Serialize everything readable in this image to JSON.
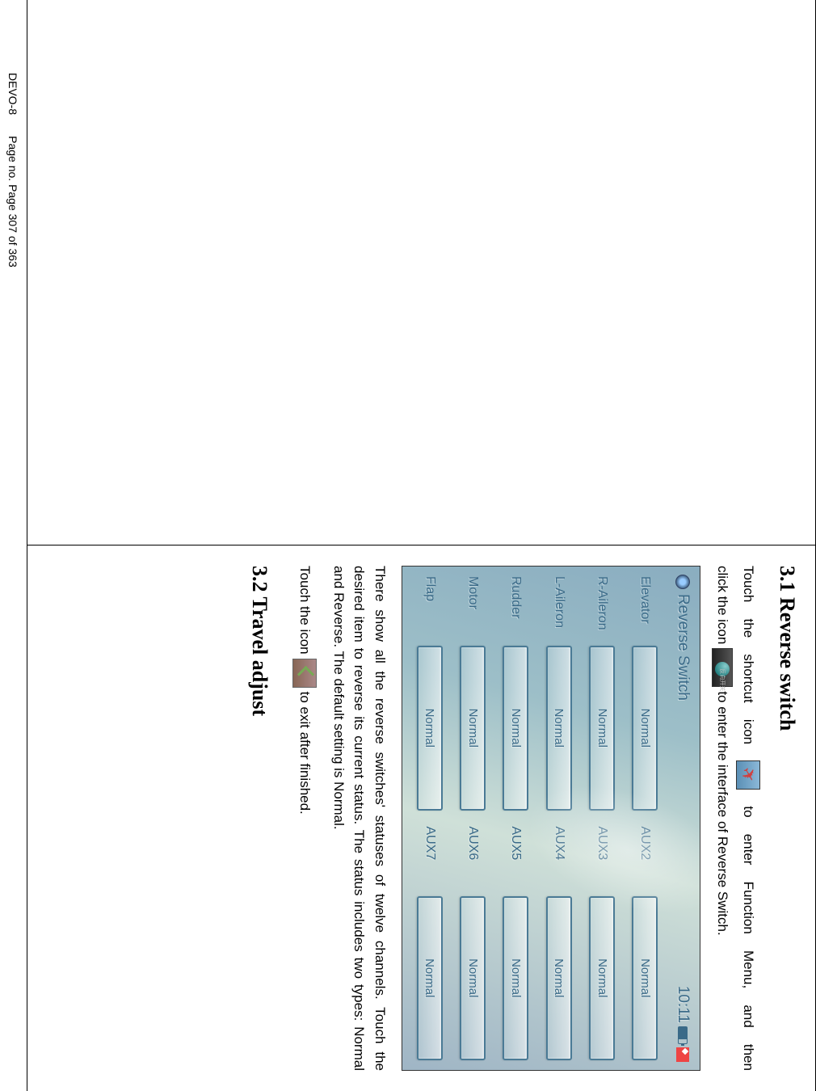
{
  "headings": {
    "reverse_switch": "3.1 Reverse switch",
    "travel_adjust": "3.2 Travel adjust"
  },
  "intro": {
    "p1a": "Touch",
    "p1b": "the",
    "p1c": "shortcut",
    "p1d": "icon",
    "p1e": "to",
    "p1f": "enter",
    "p1g": "Function",
    "p1h": "Menu,",
    "p1i": "and",
    "p1j": "then",
    "p2a": "click the icon",
    "p2b": " to enter the interface of Reverse Switch."
  },
  "screen": {
    "title": "Reverse Switch",
    "clock": "10:11",
    "channels": [
      {
        "name": "Elevator",
        "value": "Normal"
      },
      {
        "name": "AUX2",
        "value": "Normal"
      },
      {
        "name": "R-Aileron",
        "value": "Normal"
      },
      {
        "name": "AUX3",
        "value": "Normal"
      },
      {
        "name": "L-Aileron",
        "value": "Normal"
      },
      {
        "name": "AUX4",
        "value": "Normal"
      },
      {
        "name": "Rudder",
        "value": "Normal"
      },
      {
        "name": "AUX5",
        "value": "Normal"
      },
      {
        "name": "Motor",
        "value": "Normal"
      },
      {
        "name": "AUX6",
        "value": "Normal"
      },
      {
        "name": "Flap",
        "value": "Normal"
      },
      {
        "name": "AUX7",
        "value": "Normal"
      }
    ]
  },
  "description": {
    "p1": "There show all the reverse switches' statuses of twelve channels. Touch the desired item to reverse its current status. The status includes two types: Normal and Reverse. The default setting is Normal.",
    "p2a": "Touch the icon",
    "p2b": " to exit after finished."
  },
  "footer": {
    "model": "DEVO-8",
    "page": "Page no. Page 307 of 363"
  }
}
